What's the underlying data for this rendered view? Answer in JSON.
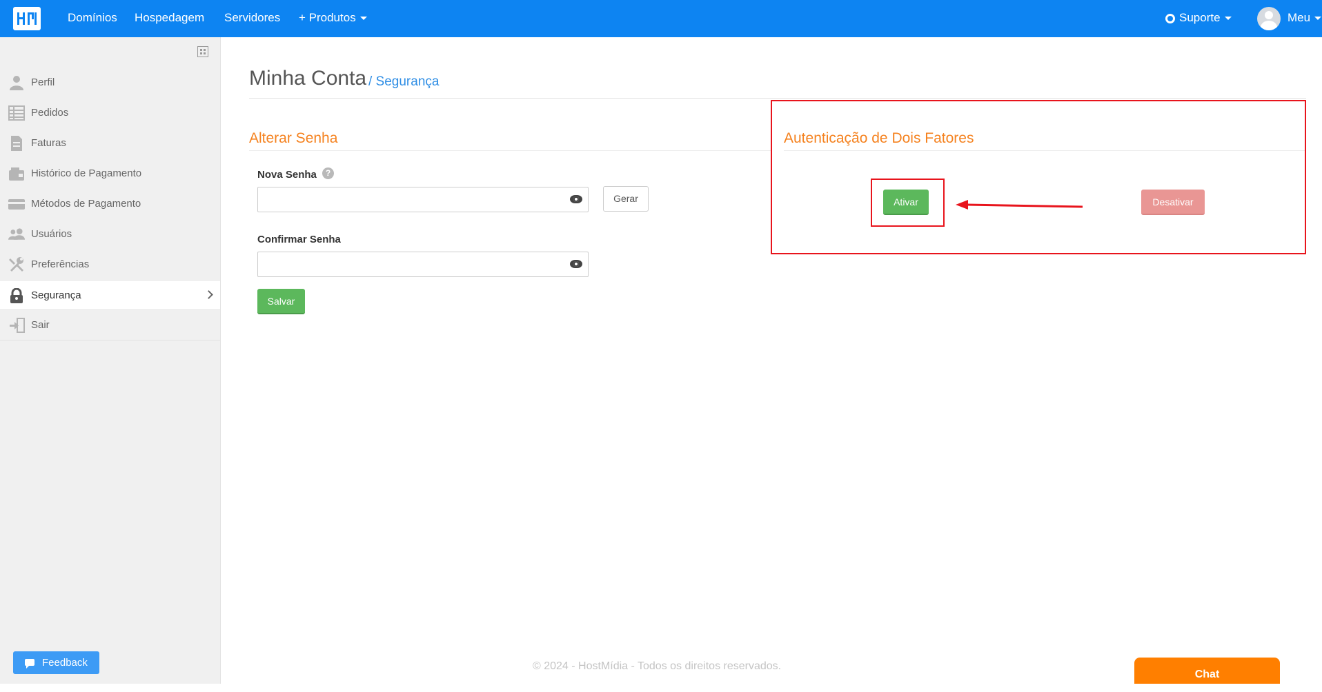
{
  "topbar": {
    "nav": [
      "Domínios",
      "Hospedagem",
      "Servidores",
      "+ Produtos"
    ],
    "support": "Suporte",
    "user": "Meu"
  },
  "sidebar": {
    "items": [
      {
        "label": "Perfil",
        "icon": "user-icon"
      },
      {
        "label": "Pedidos",
        "icon": "table-icon"
      },
      {
        "label": "Faturas",
        "icon": "invoice-icon"
      },
      {
        "label": "Histórico de Pagamento",
        "icon": "wallet-icon"
      },
      {
        "label": "Métodos de Pagamento",
        "icon": "credit-card-icon"
      },
      {
        "label": "Usuários",
        "icon": "users-icon"
      },
      {
        "label": "Preferências",
        "icon": "tools-icon"
      },
      {
        "label": "Segurança",
        "icon": "lock-icon"
      },
      {
        "label": "Sair",
        "icon": "logout-icon"
      }
    ],
    "feedback": "Feedback"
  },
  "main": {
    "title": "Minha Conta",
    "breadcrumb": "/ Segurança",
    "change_password": {
      "title": "Alterar Senha",
      "new_password_label": "Nova Senha",
      "help": "?",
      "generate": "Gerar",
      "confirm_password_label": "Confirmar Senha",
      "save": "Salvar"
    },
    "two_factor": {
      "title": "Autenticação de Dois Fatores",
      "enable": "Ativar",
      "disable": "Desativar"
    }
  },
  "footer": "© 2024 - HostMídia - Todos os direitos reservados.",
  "chat": "Chat",
  "colors": {
    "brand": "#0d84f2",
    "accent": "#f5821f",
    "success": "#5cb85c",
    "danger": "#e99694",
    "annotation": "#e8141c"
  }
}
